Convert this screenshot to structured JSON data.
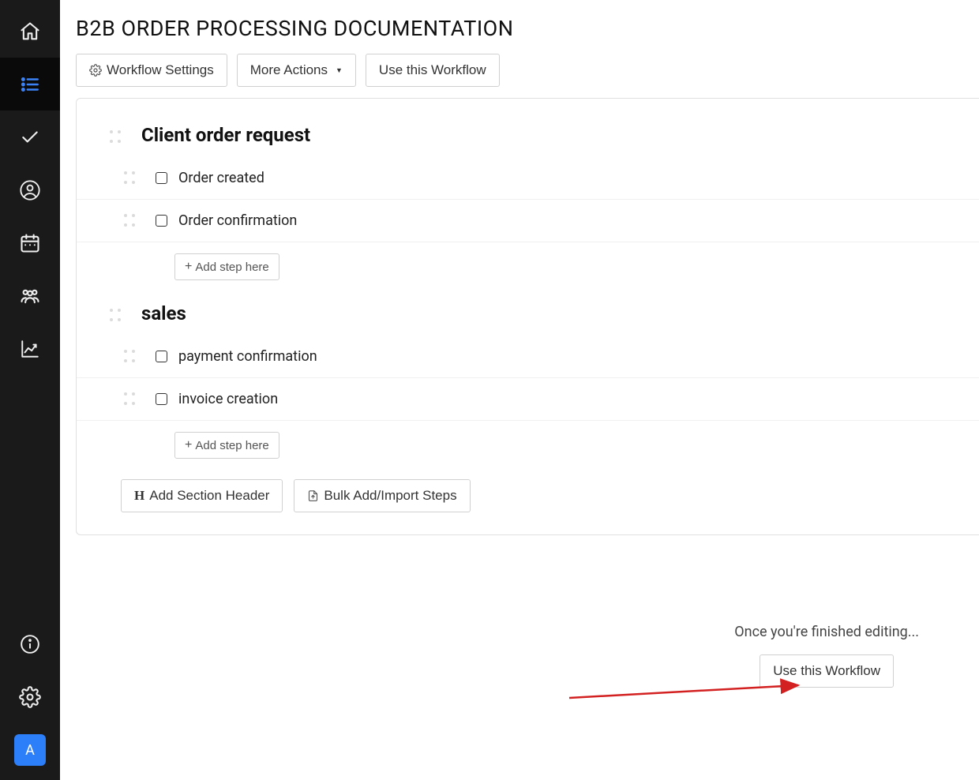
{
  "page": {
    "title": "B2B ORDER PROCESSING DOCUMENTATION"
  },
  "toolbar": {
    "workflow_settings": "Workflow Settings",
    "more_actions": "More Actions",
    "use_workflow": "Use this Workflow"
  },
  "sections": [
    {
      "title": "Client order request",
      "steps": [
        "Order created",
        "Order confirmation"
      ],
      "add_step": "Add step here"
    },
    {
      "title": "sales",
      "steps": [
        "payment confirmation",
        "invoice creation"
      ],
      "add_step": "Add step here"
    }
  ],
  "bottom_actions": {
    "add_section": "Add Section Header",
    "bulk_import": "Bulk Add/Import Steps"
  },
  "footer": {
    "note": "Once you're finished editing...",
    "use_workflow": "Use this Workflow"
  },
  "avatar": {
    "initial": "A"
  },
  "icons": {
    "plus": "+",
    "caret": "▼"
  }
}
